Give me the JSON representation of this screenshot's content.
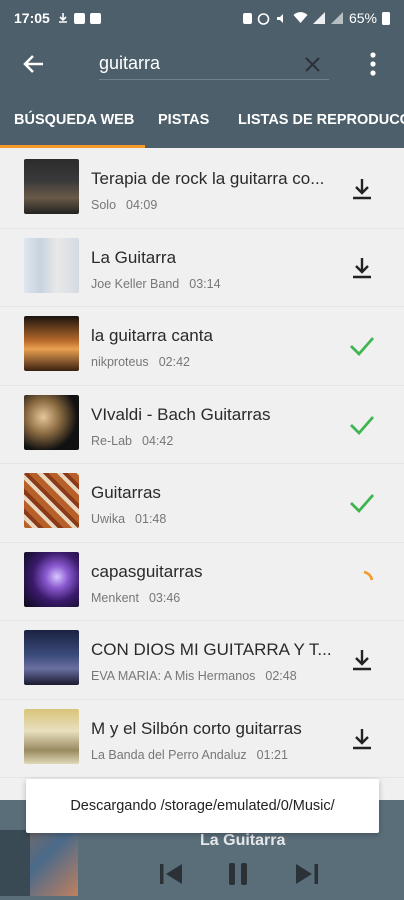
{
  "status_bar": {
    "time": "17:05",
    "battery": "65%"
  },
  "search": {
    "value": "guitarra"
  },
  "tabs": [
    {
      "label": "BÚSQUEDA WEB",
      "active": true
    },
    {
      "label": "PISTAS",
      "active": false
    },
    {
      "label": "LISTAS DE REPRODUCCIÓN",
      "active": false
    }
  ],
  "tracks": [
    {
      "title": "Terapia de rock  la guitarra co...",
      "artist": "Solo",
      "duration": "04:09",
      "status": "download"
    },
    {
      "title": "La Guitarra",
      "artist": "Joe Keller Band",
      "duration": "03:14",
      "status": "download"
    },
    {
      "title": "la guitarra canta",
      "artist": "nikproteus",
      "duration": "02:42",
      "status": "downloaded"
    },
    {
      "title": "VIvaldi - Bach Guitarras",
      "artist": "Re-Lab",
      "duration": "04:42",
      "status": "downloaded"
    },
    {
      "title": "Guitarras",
      "artist": "Uwika",
      "duration": "01:48",
      "status": "downloaded"
    },
    {
      "title": "capasguitarras",
      "artist": "Menkent",
      "duration": "03:46",
      "status": "downloading"
    },
    {
      "title": "CON DIOS MI GUITARRA Y T...",
      "artist": "EVA MARIA: A Mis Hermanos",
      "duration": "02:48",
      "status": "download"
    },
    {
      "title": "M  y el Silbón corto guitarras",
      "artist": "La Banda del Perro Andaluz",
      "duration": "01:21",
      "status": "download"
    }
  ],
  "player": {
    "title": "La Guitarra"
  },
  "toast": {
    "message": "Descargando /storage/emulated/0/Music/"
  },
  "colors": {
    "toolbar": "#4d5f6a",
    "accent": "#f39a2b",
    "check": "#3fb54f"
  }
}
